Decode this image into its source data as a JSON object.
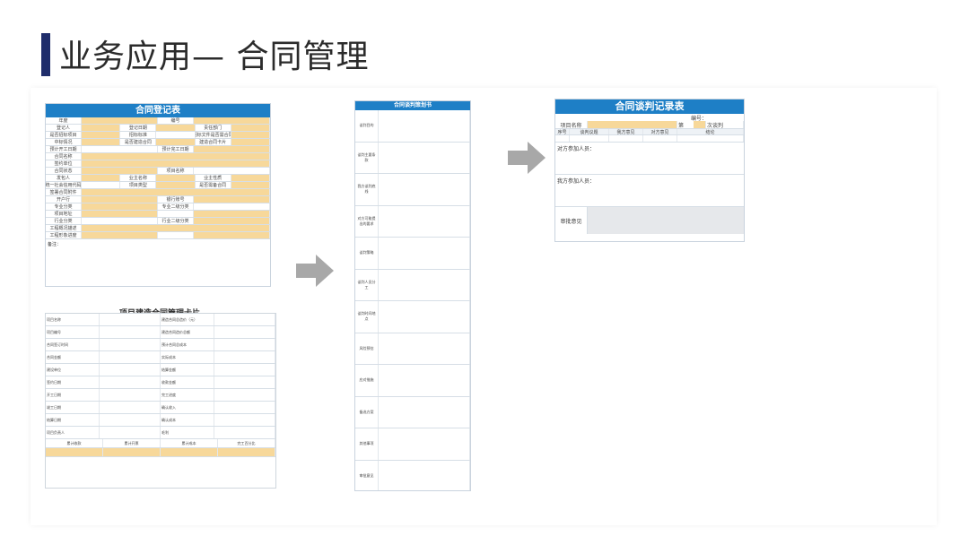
{
  "slide": {
    "title": "业务应用— 合同管理"
  },
  "register_form": {
    "title": "合同登记表",
    "rows": [
      [
        "年度",
        "",
        "编号",
        ""
      ],
      [
        "登记人",
        "",
        "登记日期",
        "",
        "责任部门",
        ""
      ],
      [
        "是否招标项目",
        "",
        "招标标准",
        "",
        "招标文件是否需合同",
        ""
      ],
      [
        "中标情况",
        "",
        "是否建造合同",
        "",
        "建造合同卡片",
        ""
      ],
      [
        "预计开工日期",
        "",
        "预计完工日期",
        ""
      ],
      [
        "合同名称",
        ""
      ],
      [
        "签约单位",
        ""
      ],
      [
        "合同状态",
        "",
        "项目名称",
        ""
      ],
      [
        "发包人",
        "",
        "业主名称",
        "",
        "业主性质",
        ""
      ],
      [
        "统一社会信用代码",
        "",
        "项目类型",
        "",
        "是否需备合同",
        ""
      ],
      [
        "签署合同附件",
        ""
      ],
      [
        "开户行",
        "",
        "银行账号",
        ""
      ],
      [
        "专业分类",
        "",
        "专业二级分类",
        ""
      ],
      [
        "项目地址",
        "",
        "",
        ""
      ],
      [
        "行业分类",
        "",
        "行业二级分类",
        ""
      ],
      [
        "工程概况描述",
        ""
      ],
      [
        "工程形象进度",
        "",
        "",
        ""
      ]
    ],
    "note_label": "备注："
  },
  "card_form": {
    "title": "项目建造合同管理卡片",
    "rows": [
      [
        "项目名称",
        "",
        "建造合同总造价（元）",
        ""
      ],
      [
        "项目编号",
        "",
        "建造合同造价总额",
        ""
      ],
      [
        "合同签订时间",
        "",
        "预计合同总成本",
        ""
      ],
      [
        "合同金额",
        "",
        "实际成本",
        ""
      ],
      [
        "建设单位",
        "",
        "结算金额",
        ""
      ],
      [
        "签约日期",
        "",
        "收款金额",
        ""
      ],
      [
        "开工日期",
        "",
        "完工进度",
        ""
      ],
      [
        "竣工日期",
        "",
        "确认收入",
        ""
      ],
      [
        "结算日期",
        "",
        "确认成本",
        ""
      ],
      [
        "项目负责人",
        "",
        "毛利",
        ""
      ]
    ],
    "footer_labels": [
      "累计收款",
      "累计开票",
      "累计成本",
      "完工百分比"
    ]
  },
  "plan_form": {
    "title": "合同谈判策划书",
    "sections": [
      "谈判目的",
      "谈判主要条款",
      "我方谈判底线",
      "对方可能提出的要求",
      "谈判策略",
      "谈判人员分工",
      "谈判时间地点",
      "风险预估",
      "应对措施",
      "备选方案",
      "其他事项",
      "审批意见"
    ]
  },
  "record_form": {
    "title": "合同谈判记录表",
    "number_label": "编号：",
    "project_label": "项目名称",
    "round_prefix": "第",
    "round_suffix": "次谈判",
    "col_headers": [
      "序号",
      "谈判议题",
      "我方意见",
      "对方意见",
      "结论"
    ],
    "other_party_label": "对方参加人员：",
    "our_party_label": "我方参加人员：",
    "approval_label": "审批意见"
  },
  "colors": {
    "header_blue": "#1e7fc6",
    "field_yellow": "#f7d89a",
    "title_bar": "#1f2d6b",
    "arrow_grey": "#a8a8a8"
  }
}
